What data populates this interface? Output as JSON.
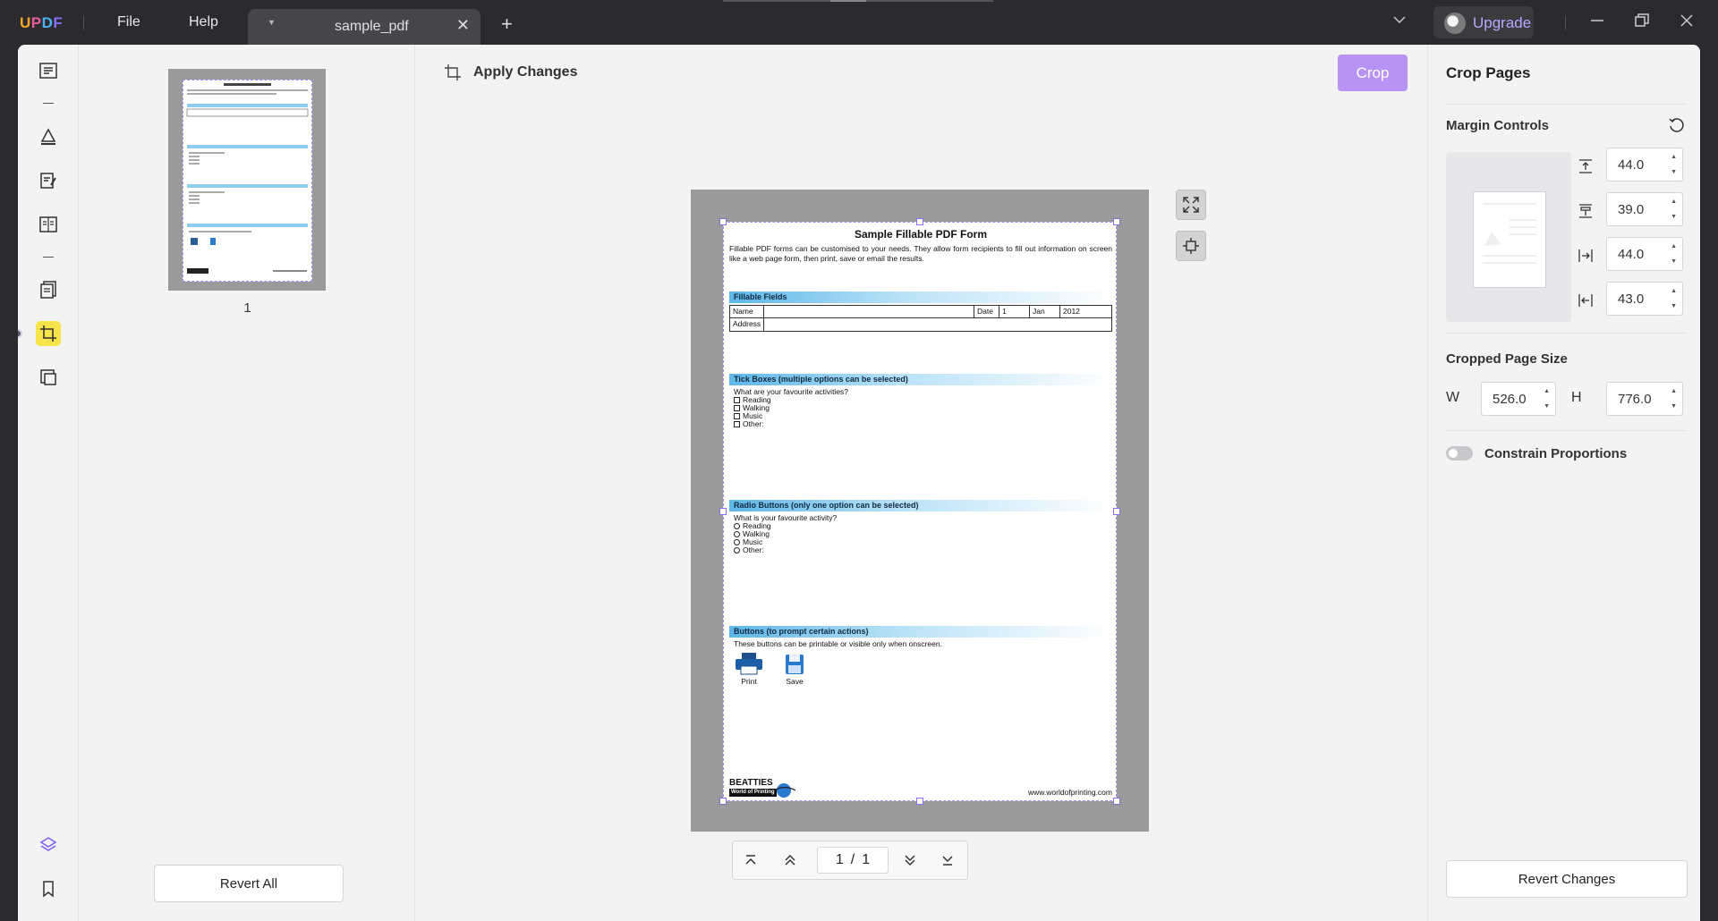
{
  "app": {
    "logo": [
      "U",
      "P",
      "D",
      "F"
    ],
    "menu": [
      "File",
      "Help"
    ],
    "tab_name": "sample_pdf",
    "upgrade_label": "Upgrade"
  },
  "toolbar": {
    "apply_changes": "Apply Changes",
    "crop": "Crop"
  },
  "thumbnails": {
    "page_number": "1",
    "revert_all": "Revert All"
  },
  "pager": {
    "current": "1",
    "separator": "/",
    "total": "1"
  },
  "pdf": {
    "title": "Sample Fillable PDF Form",
    "intro": "Fillable PDF forms can be customised to your needs. They allow form recipients to fill out information on screen like a web page form, then print, save or email the results.",
    "sections": {
      "fields": "Fillable Fields",
      "ticks": "Tick Boxes (multiple options can be selected)",
      "radios": "Radio Buttons (only one option can be selected)",
      "buttons": "Buttons (to prompt certain actions)"
    },
    "name_label": "Name",
    "address_label": "Address",
    "date_label": "Date",
    "date_day": "1",
    "date_month": "Jan",
    "date_year": "2012",
    "tick_question": "What are your favourite activities?",
    "tick_options": [
      "Reading",
      "Walking",
      "Music",
      "Other:"
    ],
    "radio_question": "What is your favourite activity?",
    "radio_options": [
      "Reading",
      "Walking",
      "Music",
      "Other:"
    ],
    "buttons_text": "These buttons can be printable or visible only when onscreen.",
    "print_label": "Print",
    "save_label": "Save",
    "footer_logo": "BEATTIES",
    "footer_logo_sub": "World of Printing",
    "footer_url": "www.worldofprinting.com"
  },
  "right_panel": {
    "title": "Crop Pages",
    "margin_controls": "Margin Controls",
    "margins": {
      "top": "44.0",
      "bottom": "39.0",
      "left": "44.0",
      "right": "43.0"
    },
    "cropped_page_size": "Cropped Page Size",
    "w_label": "W",
    "h_label": "H",
    "width": "526.0",
    "height": "776.0",
    "constrain_proportions": "Constrain Proportions",
    "revert_changes": "Revert Changes"
  },
  "colors": {
    "accent": "#b794f4",
    "crop_border": "#a78bfa",
    "active_tool": "#f7e34a"
  }
}
